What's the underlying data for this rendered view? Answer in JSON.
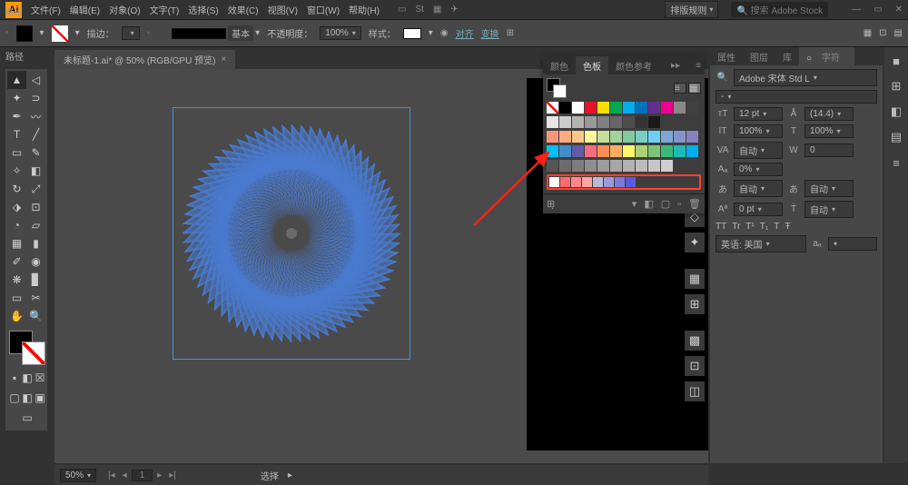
{
  "app": {
    "logo": "Ai"
  },
  "menu": [
    "文件(F)",
    "编辑(E)",
    "对象(O)",
    "文字(T)",
    "选择(S)",
    "效果(C)",
    "视图(V)",
    "窗口(W)",
    "帮助(H)"
  ],
  "topright": {
    "workspace": "排版规则",
    "search": "搜索 Adobe Stock"
  },
  "control": {
    "label": "路径",
    "strokeLabel": "描边：",
    "strokeDD": "",
    "basic": "基本",
    "opacityLabel": "不透明度：",
    "opacity": "100%",
    "styleLabel": "样式：",
    "align": "对齐",
    "transform": "变换"
  },
  "tab": {
    "title": "未标题-1.ai* @ 50% (RGB/GPU 预览)"
  },
  "status": {
    "zoom": "50%",
    "page": "1",
    "toolLabel": "选择"
  },
  "swatchPanel": {
    "tabs": [
      "颜色",
      "色板",
      "颜色参考"
    ],
    "active": 1,
    "rows": [
      [
        "#ffffff:none",
        "#000000",
        "#ffffff",
        "#e81123",
        "#ffde00",
        "#00a651",
        "#00aeef",
        "#0072bc",
        "#662d91",
        "#ec008c",
        "#898989",
        "#414141"
      ],
      [
        "#e6e6e6",
        "#cccccc",
        "#b3b3b3",
        "#999999",
        "#808080",
        "#666666",
        "#4d4d4d",
        "#333333",
        "#1a1a1a"
      ],
      [
        "#f7977a",
        "#f9ad81",
        "#fdc68a",
        "#fff79a",
        "#c4df9b",
        "#a2d39c",
        "#82ca9d",
        "#7bcdc8",
        "#6ecff6",
        "#7ea7d8",
        "#8493ca",
        "#8882be"
      ],
      [
        "#00bff3",
        "#438ccb",
        "#605ca8",
        "#f26d7d",
        "#f68e56",
        "#fbaf5d",
        "#fff568",
        "#acd373",
        "#7cc576",
        "#3cb878",
        "#1cbbb4",
        "#00aeef"
      ],
      [
        "#555555",
        "#6b6b6b",
        "#7d7d7d",
        "#8e8e8e",
        "#9c9c9c",
        "#a7a7a7",
        "#b2b2b2",
        "#bcbcbc",
        "#c6c6c6",
        "#d0d0d0"
      ]
    ],
    "highlighted": [
      "#ffffff",
      "#ff6b6b",
      "#ff8787",
      "#ffa3a3",
      "#b8b8d8",
      "#9a9ad8",
      "#7a7ad8",
      "#5a5ad8"
    ]
  },
  "charPanel": {
    "tabs": [
      "属性",
      "图层",
      "库",
      "字符"
    ],
    "active": 3,
    "font": "Adobe 宋体 Std L",
    "fontStyle": "-",
    "size": "12 pt",
    "leading": "(14.4)",
    "kerning": "0",
    "tracking": "100%",
    "vscale": "自动",
    "baseline": "0",
    "hscale": "0 pt",
    "rotate": "自动",
    "opts": [
      "TT",
      "Tr",
      "T¹",
      "T₁",
      "T",
      "Ŧ"
    ],
    "lang": "英语: 美国",
    "aa": "aₐ"
  },
  "sideIcons": [
    "◐",
    "◆",
    "◈",
    "◊",
    "❖",
    "◇",
    "✦",
    "▦",
    "⊞",
    "▩",
    "⊡",
    "◫"
  ],
  "railIcons": [
    "■",
    "⊞",
    "◧",
    "▤",
    "≡"
  ]
}
